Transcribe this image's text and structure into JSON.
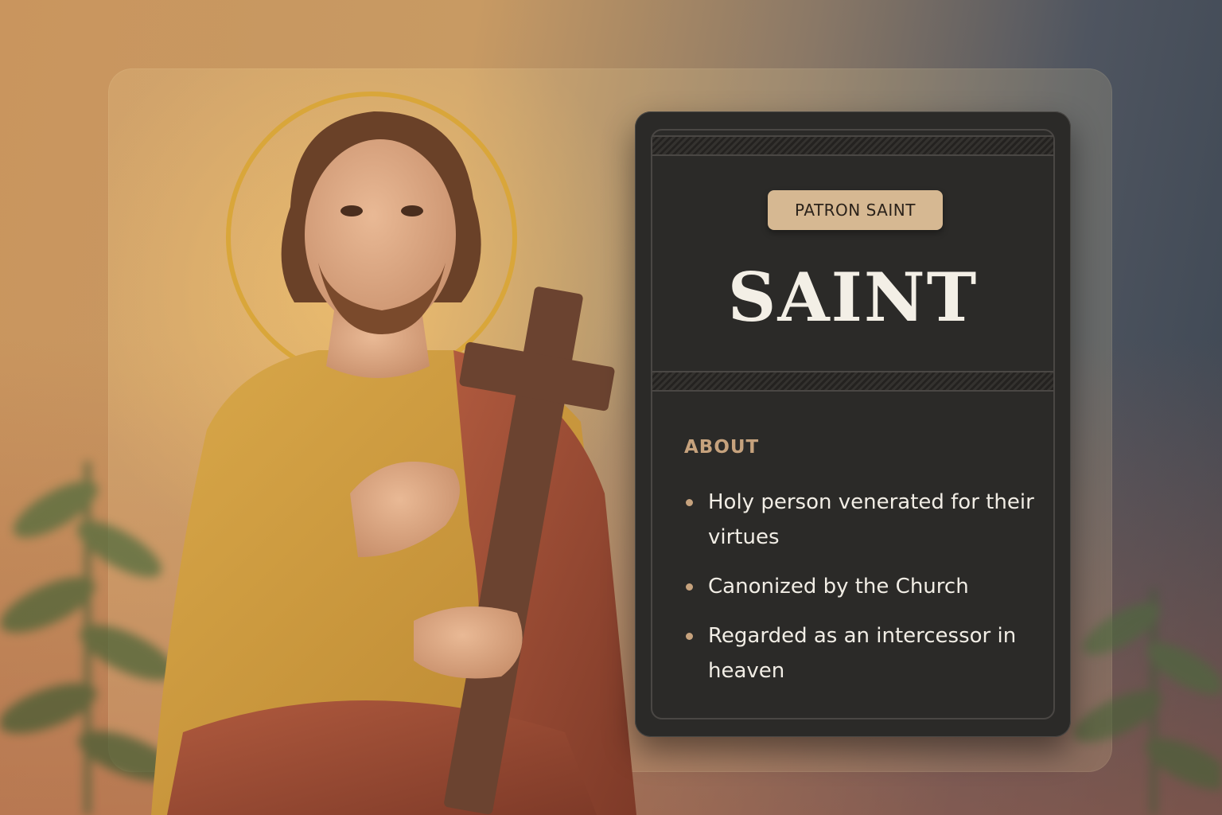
{
  "card": {
    "badge": "PATRON SAINT",
    "title": "SAINT",
    "section_label": "ABOUT",
    "bullets": [
      "Holy person venerated for their virtues",
      "Canonized by the Church",
      "Regarded as an intercessor in heaven"
    ]
  },
  "colors": {
    "card_bg": "#2b2a28",
    "badge_bg": "#d6b892",
    "accent": "#c6a27d",
    "halo": "#d9a63a"
  },
  "icons": {
    "bullet": "bullet-dot-icon"
  }
}
